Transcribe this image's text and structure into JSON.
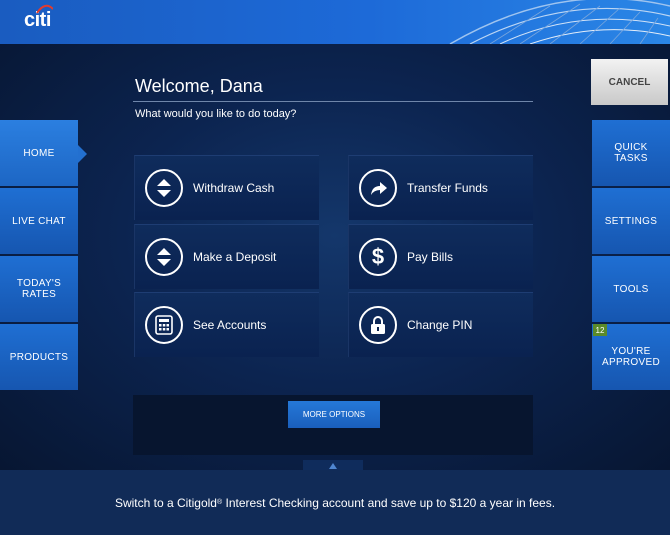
{
  "header": {
    "logo_text": "citi"
  },
  "welcome": {
    "title": "Welcome, Dana",
    "subtitle": "What would you like to do today?"
  },
  "left_nav": [
    {
      "label": "HOME"
    },
    {
      "label": "LIVE CHAT"
    },
    {
      "label": "TODAY'S RATES"
    },
    {
      "label": "PRODUCTS"
    }
  ],
  "right_nav": {
    "cancel": "CANCEL",
    "items": [
      {
        "label": "QUICK TASKS"
      },
      {
        "label": "SETTINGS"
      },
      {
        "label": "TOOLS"
      },
      {
        "label": "YOU'RE APPROVED",
        "badge": "12"
      }
    ]
  },
  "actions": [
    {
      "label": "Withdraw Cash",
      "icon": "withdraw-icon"
    },
    {
      "label": "Transfer Funds",
      "icon": "transfer-arrow-icon"
    },
    {
      "label": "Make a Deposit",
      "icon": "deposit-icon"
    },
    {
      "label": "Pay Bills",
      "icon": "dollar-icon"
    },
    {
      "label": "See Accounts",
      "icon": "calculator-icon"
    },
    {
      "label": "Change PIN",
      "icon": "lock-icon"
    }
  ],
  "more_options": "MORE OPTIONS",
  "footer": {
    "text_before": "Switch to a Citigold",
    "sup": "®",
    "text_after": " Interest Checking account and save up to $120 a year in fees."
  },
  "colors": {
    "accent": "#1d6ad8",
    "background": "#0a1b3a",
    "badge": "#5a8a2a"
  }
}
